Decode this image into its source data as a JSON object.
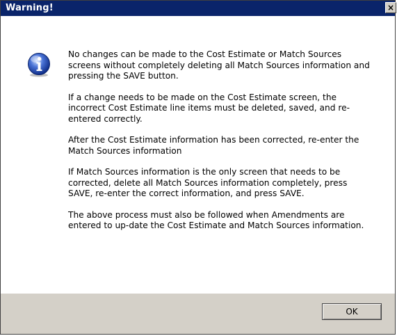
{
  "dialog": {
    "title": "Warning!",
    "close_label": "×",
    "icon": "info-icon",
    "messages": [
      "No changes can be made to the Cost Estimate or Match Sources screens without completely deleting all Match Sources information and pressing the SAVE button.",
      "If a change needs to be made on the Cost Estimate screen, the incorrect Cost Estimate line items must be deleted, saved, and re-entered correctly.",
      "After the Cost Estimate information has been corrected, re-enter the Match Sources information",
      "If Match Sources information is the only screen that needs to be corrected, delete all Match Sources information completely, press SAVE, re-enter the correct information, and press SAVE.",
      "The above process must also be followed when Amendments are entered to up-date the Cost Estimate and Match Sources information."
    ],
    "ok_label": "OK"
  },
  "colors": {
    "titlebar": "#0a246a",
    "title_text": "#ffffff",
    "footer": "#d4d0c8",
    "content_bg": "#ffffff"
  }
}
